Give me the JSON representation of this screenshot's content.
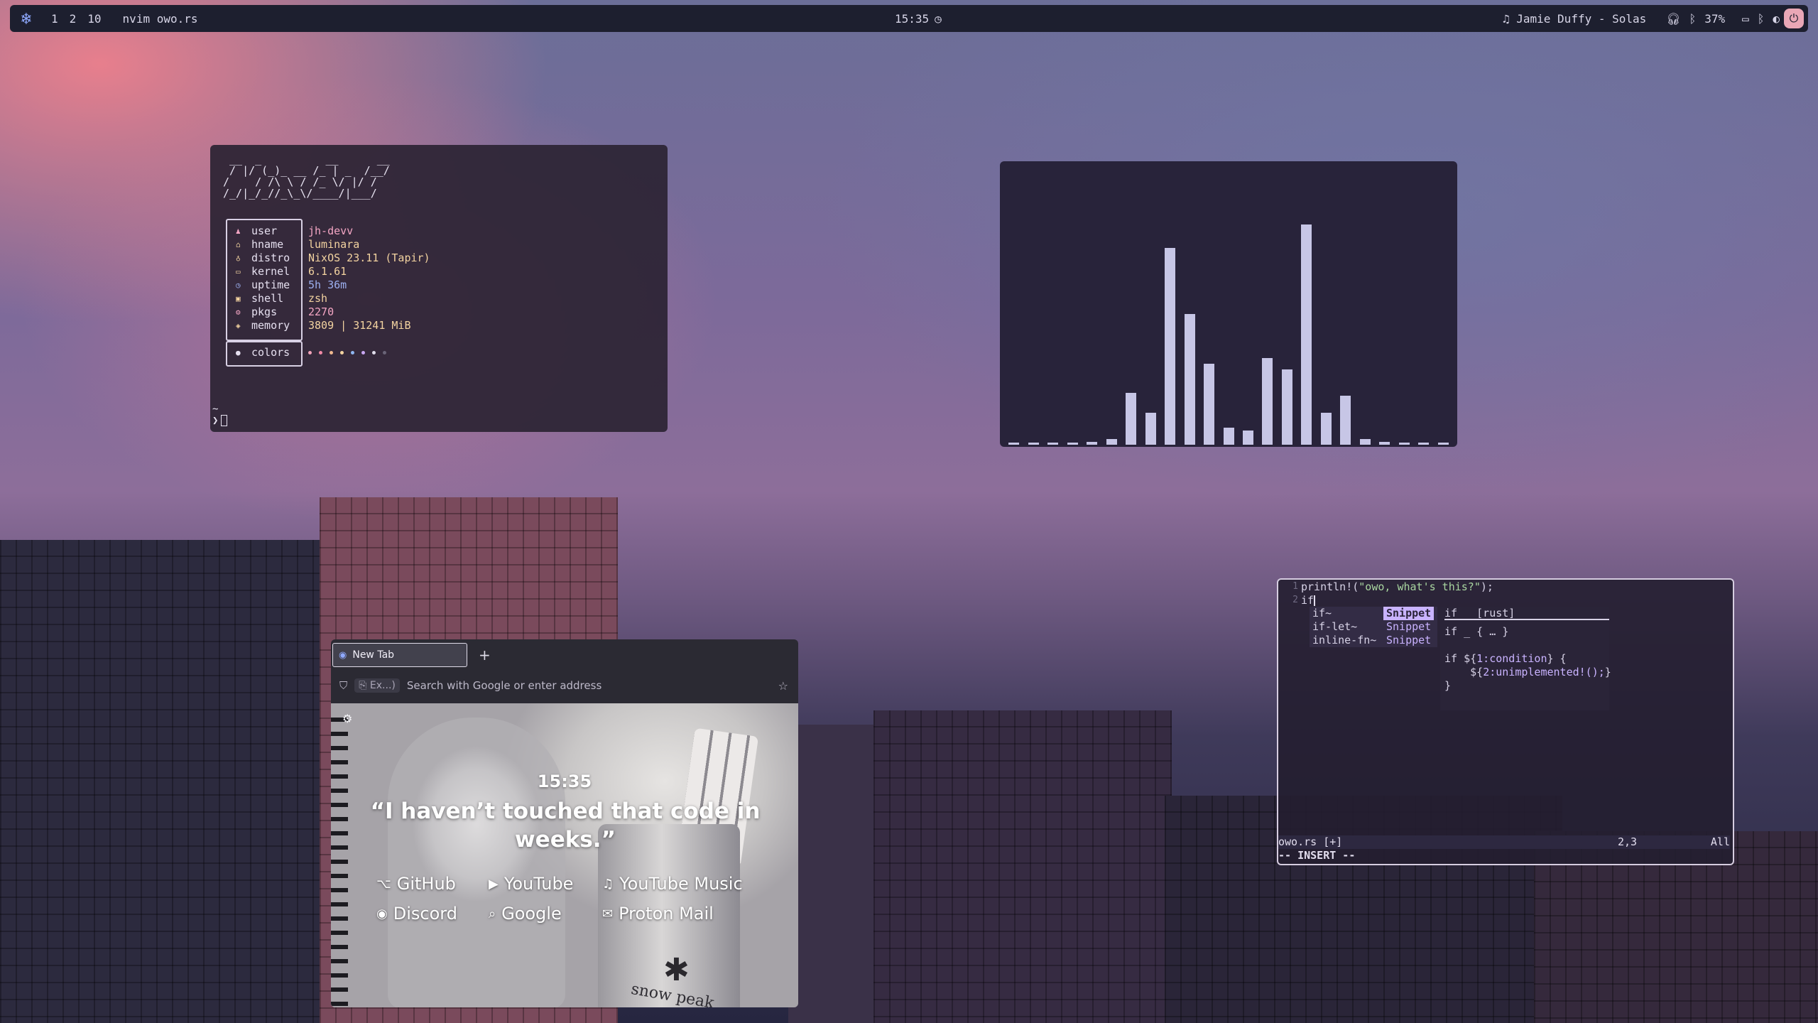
{
  "topbar": {
    "workspaces": [
      "1",
      "2",
      "10"
    ],
    "window_title": "nvim owo.rs",
    "clock": "15:35",
    "media": "Jamie Duffy - Solas",
    "battery": "37%"
  },
  "terminal": {
    "ascii_logo": " __  _          __      __\n / |/ (_)_ __ /_ | _  /__/\n/    / /\\ \\ / /_ \\/ |/ /\n/_/|_/_//_\\_\\/____/|___/",
    "rows": [
      {
        "key": "user",
        "value": "jh-devv",
        "color": "#f4a6c4"
      },
      {
        "key": "hname",
        "value": "luminara",
        "color": "#f3d3a0"
      },
      {
        "key": "distro",
        "value": "NixOS 23.11 (Tapir)",
        "color": "#f3d3a0"
      },
      {
        "key": "kernel",
        "value": "6.1.61",
        "color": "#f3d3a0"
      },
      {
        "key": "uptime",
        "value": "5h 36m",
        "color": "#9db0f0"
      },
      {
        "key": "shell",
        "value": "zsh",
        "color": "#f3d3a0"
      },
      {
        "key": "pkgs",
        "value": "2270",
        "color": "#f4a6c4"
      },
      {
        "key": "memory",
        "value": "3809 | 31241 MiB",
        "color": "#f3d3a0"
      }
    ],
    "colors_label": "colors",
    "palette": [
      "#f2a2b8",
      "#f28aa6",
      "#f0b98f",
      "#f3d3a0",
      "#8fb6f0",
      "#c9a7f2",
      "#e0ddeb",
      "#6a6478"
    ],
    "prompt_tilde": "~",
    "prompt_symbol": "❯"
  },
  "visualizer": {
    "levels": [
      0.0,
      0.0,
      0.0,
      0.0,
      0.01,
      0.02,
      0.18,
      0.11,
      0.68,
      0.45,
      0.28,
      0.06,
      0.05,
      0.3,
      0.26,
      0.76,
      0.11,
      0.17,
      0.02,
      0.01,
      0.0,
      0.0,
      0.0
    ]
  },
  "nvim": {
    "lines": [
      {
        "num": "1",
        "pre": "println!(",
        "str": "\"owo, what's this?\"",
        "post": ");"
      },
      {
        "num": "2",
        "pre": "if",
        "str": "",
        "post": ""
      }
    ],
    "completion": [
      {
        "word": "if~",
        "kind": "Snippet",
        "selected": true
      },
      {
        "word": "if-let~",
        "kind": "Snippet",
        "selected": false
      },
      {
        "word": "inline-fn~",
        "kind": "Snippet",
        "selected": false
      }
    ],
    "doc": {
      "header": "if _ [rust]",
      "sig": "if _ { … }",
      "body1_pre": "if ${",
      "body1_ph": "1:condition",
      "body1_post": "} {",
      "body2_pre": "    ${",
      "body2_ph": "2:unimplemented!();",
      "body2_post": "}",
      "body3": "}"
    },
    "status_file": "owo.rs [+]",
    "status_pos": "2,3",
    "status_scroll": "All",
    "mode": "-- INSERT --"
  },
  "browser": {
    "tab_title": "New Tab",
    "new_tab_symbol": "+",
    "url_chip": "Ex...)",
    "url_placeholder": "Search with Google or enter address",
    "newtab_clock": "15:35",
    "quote": "“I haven’t touched that code in weeks.”",
    "mug_text": "snow peak",
    "links": [
      {
        "label": "GitHub",
        "icon": "github-icon",
        "glyph": "⌥"
      },
      {
        "label": "YouTube",
        "icon": "youtube-icon",
        "glyph": "▶"
      },
      {
        "label": "YouTube Music",
        "icon": "music-icon",
        "glyph": "♫"
      },
      {
        "label": "Discord",
        "icon": "discord-icon",
        "glyph": "◉"
      },
      {
        "label": "Google",
        "icon": "search-icon",
        "glyph": "⌕"
      },
      {
        "label": "Proton Mail",
        "icon": "mail-icon",
        "glyph": "✉"
      }
    ]
  }
}
